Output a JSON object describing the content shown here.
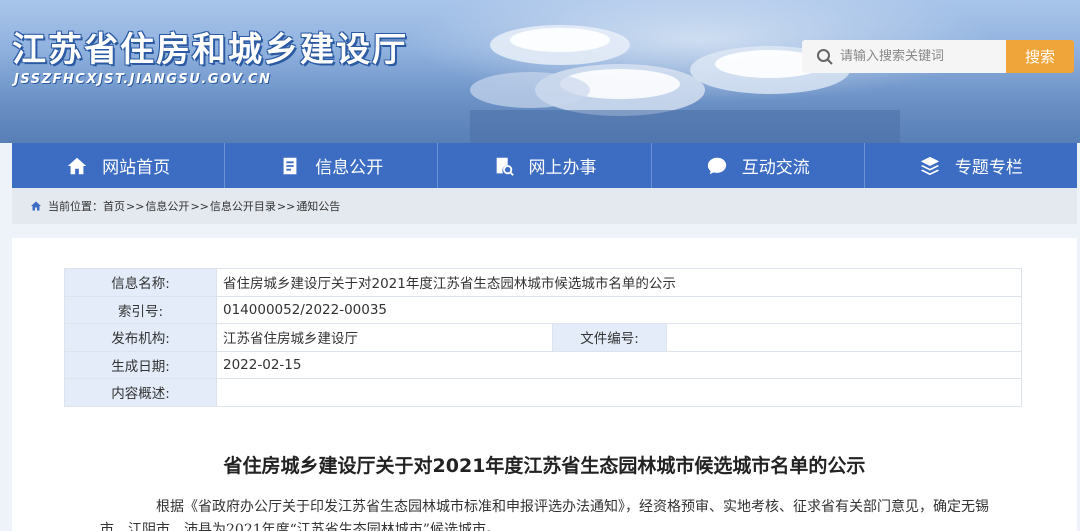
{
  "header": {
    "site_title": "江苏省住房和城乡建设厅",
    "site_domain": "JSSZFHCXJST.JIANGSU.GOV.CN"
  },
  "search": {
    "placeholder": "请输入搜索关键词",
    "button_label": "搜索"
  },
  "nav": {
    "items": [
      {
        "label": "网站首页",
        "icon": "home-icon"
      },
      {
        "label": "信息公开",
        "icon": "document-icon"
      },
      {
        "label": "网上办事",
        "icon": "search-doc-icon"
      },
      {
        "label": "互动交流",
        "icon": "chat-icon"
      },
      {
        "label": "专题专栏",
        "icon": "layers-icon"
      }
    ]
  },
  "breadcrumb": {
    "prefix": "当前位置：",
    "items": [
      "首页",
      "信息公开",
      "信息公开目录",
      "通知公告"
    ],
    "separator": ">>"
  },
  "meta": {
    "name_label": "信息名称:",
    "name_value": "省住房城乡建设厅关于对2021年度江苏省生态园林城市候选城市名单的公示",
    "index_label": "索引号:",
    "index_value": "014000052/2022-00035",
    "publisher_label": "发布机构:",
    "publisher_value": "江苏省住房城乡建设厅",
    "file_no_label": "文件编号:",
    "file_no_value": "",
    "date_label": "生成日期:",
    "date_value": "2022-02-15",
    "summary_label": "内容概述:",
    "summary_value": ""
  },
  "article": {
    "title": "省住房城乡建设厅关于对2021年度江苏省生态园林城市候选城市名单的公示",
    "body": "根据《省政府办公厅关于印发江苏省生态园林城市标准和申报评选办法通知》，经资格预审、实地考核、征求省有关部门意见，确定无锡市、江阴市、沛县为2021年度“江苏省生态园林城市”候选城市。"
  },
  "colors": {
    "nav_bg": "#3d6cc3",
    "search_button": "#f0a53a",
    "label_cell_bg": "#e3ecf8"
  }
}
